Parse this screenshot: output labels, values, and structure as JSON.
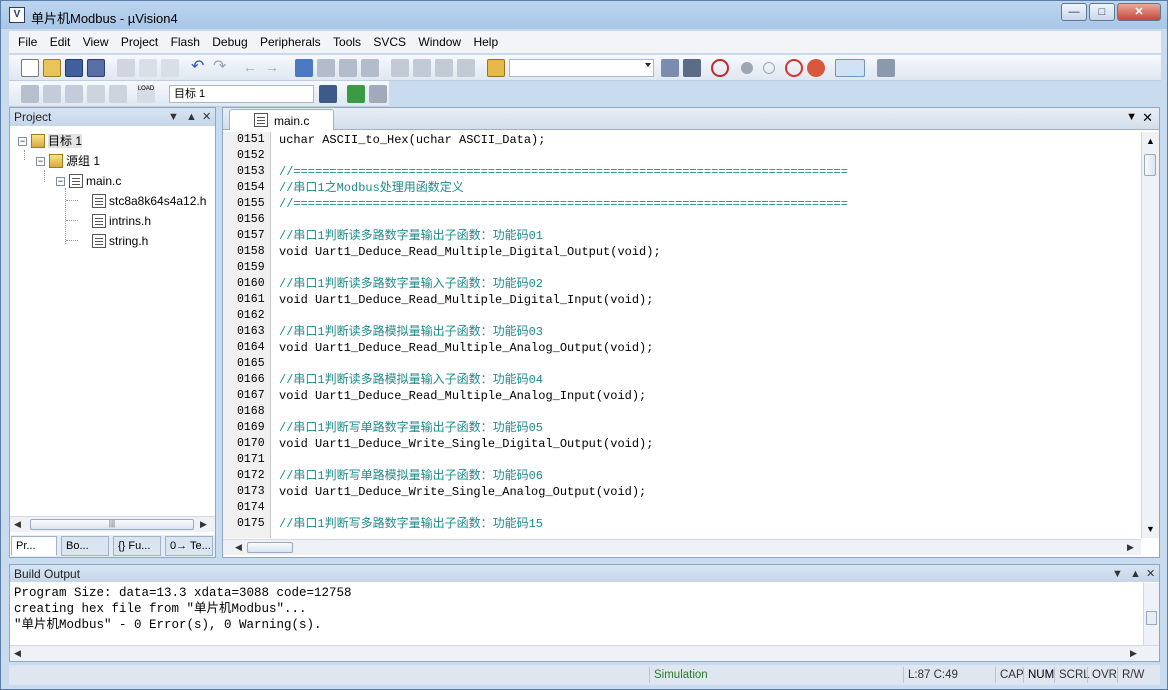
{
  "window": {
    "title": "单片机Modbus - µVision4",
    "app_icon": "V"
  },
  "menu": [
    "File",
    "Edit",
    "View",
    "Project",
    "Flash",
    "Debug",
    "Peripherals",
    "Tools",
    "SVCS",
    "Window",
    "Help"
  ],
  "toolbar": {
    "target_combo": "目标 1"
  },
  "project_panel": {
    "title": "Project",
    "tree": {
      "target": "目标 1",
      "group": "源组 1",
      "file": "main.c",
      "includes": [
        "stc8a8k64s4a12.h",
        "intrins.h",
        "string.h"
      ]
    },
    "tabs": [
      "Pr...",
      "Bo...",
      "{} Fu...",
      "0→ Te..."
    ]
  },
  "editor": {
    "active_tab": "main.c",
    "lines": [
      {
        "n": "0151",
        "t": "uchar ASCII_to_Hex(uchar ASCII_Data);",
        "c": false
      },
      {
        "n": "0152",
        "t": "",
        "c": false
      },
      {
        "n": "0153",
        "t": "//=============================================================================",
        "c": true
      },
      {
        "n": "0154",
        "t": "//串口1之Modbus处理用函数定义",
        "c": true
      },
      {
        "n": "0155",
        "t": "//=============================================================================",
        "c": true
      },
      {
        "n": "0156",
        "t": "",
        "c": false
      },
      {
        "n": "0157",
        "t": "//串口1判断读多路数字量输出子函数：功能码01",
        "c": true
      },
      {
        "n": "0158",
        "t": "void Uart1_Deduce_Read_Multiple_Digital_Output(void);",
        "c": false
      },
      {
        "n": "0159",
        "t": "",
        "c": false
      },
      {
        "n": "0160",
        "t": "//串口1判断读多路数字量输入子函数：功能码02",
        "c": true
      },
      {
        "n": "0161",
        "t": "void Uart1_Deduce_Read_Multiple_Digital_Input(void);",
        "c": false
      },
      {
        "n": "0162",
        "t": "",
        "c": false
      },
      {
        "n": "0163",
        "t": "//串口1判断读多路模拟量输出子函数：功能码03",
        "c": true
      },
      {
        "n": "0164",
        "t": "void Uart1_Deduce_Read_Multiple_Analog_Output(void);",
        "c": false
      },
      {
        "n": "0165",
        "t": "",
        "c": false
      },
      {
        "n": "0166",
        "t": "//串口1判断读多路模拟量输入子函数：功能码04",
        "c": true
      },
      {
        "n": "0167",
        "t": "void Uart1_Deduce_Read_Multiple_Analog_Input(void);",
        "c": false
      },
      {
        "n": "0168",
        "t": "",
        "c": false
      },
      {
        "n": "0169",
        "t": "//串口1判断写单路数字量输出子函数：功能码05",
        "c": true
      },
      {
        "n": "0170",
        "t": "void Uart1_Deduce_Write_Single_Digital_Output(void);",
        "c": false
      },
      {
        "n": "0171",
        "t": "",
        "c": false
      },
      {
        "n": "0172",
        "t": "//串口1判断写单路模拟量输出子函数：功能码06",
        "c": true
      },
      {
        "n": "0173",
        "t": "void Uart1_Deduce_Write_Single_Analog_Output(void);",
        "c": false
      },
      {
        "n": "0174",
        "t": "",
        "c": false
      },
      {
        "n": "0175",
        "t": "//串口1判断写多路数字量输出子函数：功能码15",
        "c": true
      }
    ]
  },
  "build_output": {
    "title": "Build Output",
    "lines": [
      "Program Size: data=13.3 xdata=3088 code=12758",
      "creating hex file from \"单片机Modbus\"...",
      "\"单片机Modbus\" - 0 Error(s), 0 Warning(s)."
    ]
  },
  "status_bar": {
    "mode": "Simulation",
    "position": "L:87 C:49",
    "indicators": [
      "CAP",
      "NUM",
      "SCRL",
      "OVR",
      "R/W"
    ]
  }
}
